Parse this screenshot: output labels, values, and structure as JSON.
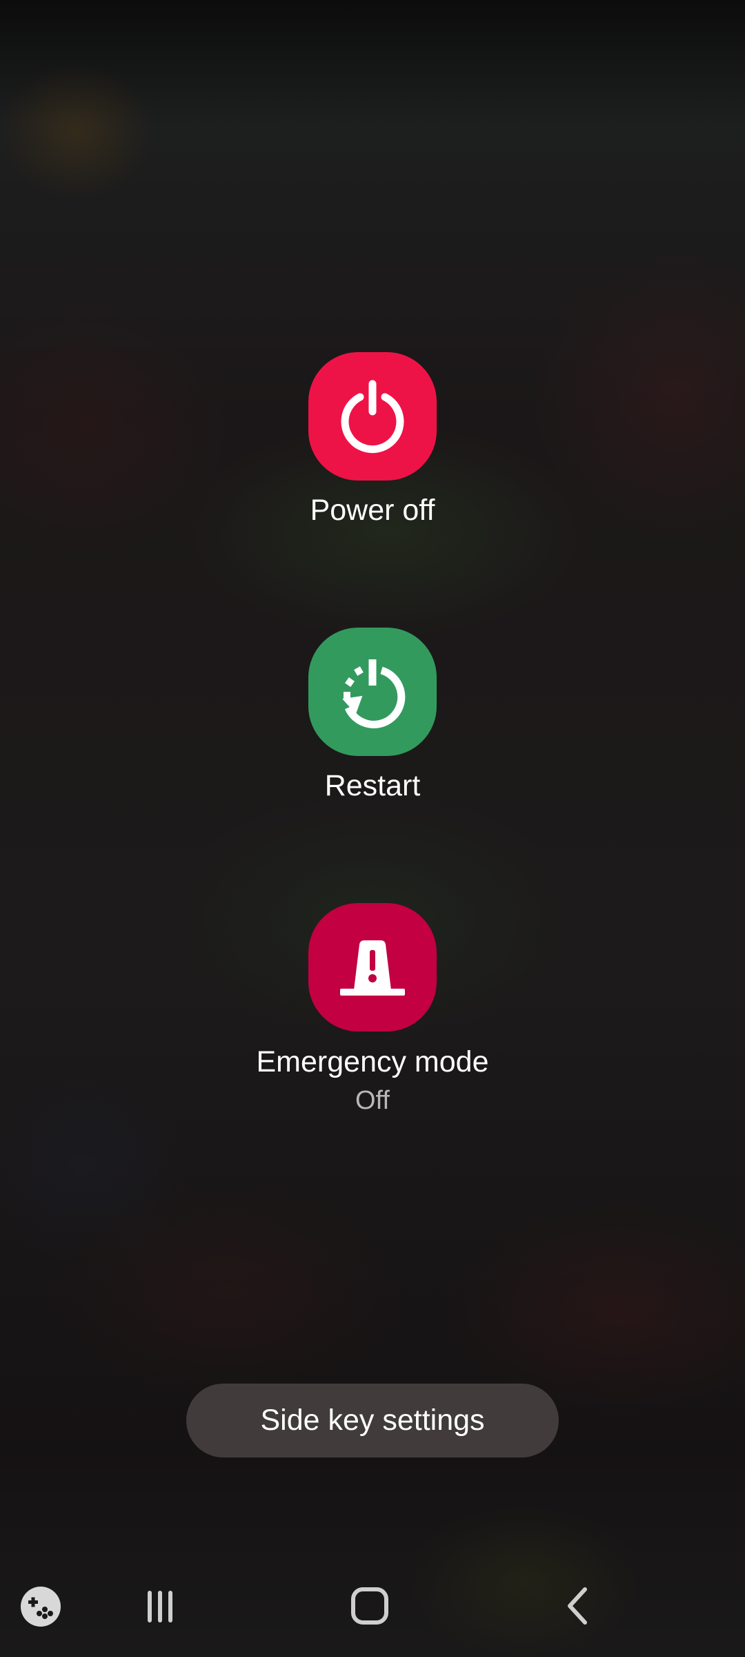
{
  "power_menu": {
    "power_off": {
      "label": "Power off",
      "icon": "power-icon",
      "color": "#ee1347"
    },
    "restart": {
      "label": "Restart",
      "icon": "restart-icon",
      "color": "#339a5e"
    },
    "emergency": {
      "label": "Emergency mode",
      "status": "Off",
      "icon": "emergency-siren-icon",
      "color": "#c20042"
    }
  },
  "side_key_settings": {
    "label": "Side key settings"
  },
  "navbar": {
    "game_launcher": {
      "icon": "game-controller-icon"
    },
    "recents": {
      "icon": "recents-icon"
    },
    "home": {
      "icon": "home-icon"
    },
    "back": {
      "icon": "back-icon"
    }
  }
}
